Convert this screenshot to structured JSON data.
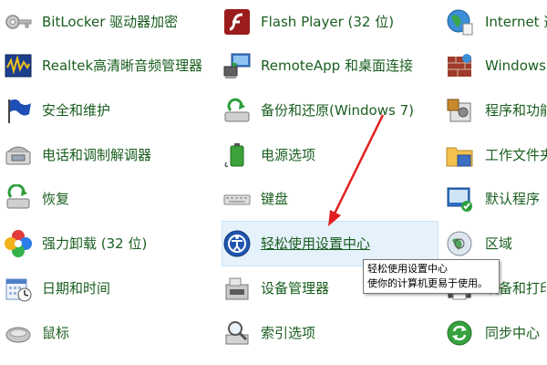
{
  "colors": {
    "link_text": "#1a5e1f",
    "hover_bg": "#e5f1fb",
    "arrow": "#e02020"
  },
  "columns": [
    {
      "items": [
        {
          "label": "BitLocker 驱动器加密",
          "icon": "bitlocker-key-icon"
        },
        {
          "label": "Realtek高清晰音频管理器",
          "icon": "realtek-audio-icon"
        },
        {
          "label": "安全和维护",
          "icon": "security-flag-icon"
        },
        {
          "label": "电话和调制解调器",
          "icon": "phone-modem-icon"
        },
        {
          "label": "恢复",
          "icon": "recovery-icon"
        },
        {
          "label": "强力卸载 (32 位)",
          "icon": "uninstall-flower-icon"
        },
        {
          "label": "日期和时间",
          "icon": "calendar-clock-icon"
        },
        {
          "label": "鼠标",
          "icon": "mouse-icon"
        }
      ]
    },
    {
      "items": [
        {
          "label": "Flash Player (32 位)",
          "icon": "flash-player-icon"
        },
        {
          "label": "RemoteApp 和桌面连接",
          "icon": "remoteapp-icon"
        },
        {
          "label": "备份和还原(Windows 7)",
          "icon": "backup-restore-icon"
        },
        {
          "label": "电源选项",
          "icon": "power-battery-icon"
        },
        {
          "label": "键盘",
          "icon": "keyboard-icon"
        },
        {
          "label": "轻松使用设置中心",
          "icon": "ease-of-access-icon"
        },
        {
          "label": "设备管理器",
          "icon": "device-manager-icon"
        },
        {
          "label": "索引选项",
          "icon": "indexing-icon"
        }
      ]
    },
    {
      "items": [
        {
          "label": "Internet 选",
          "icon": "internet-globe-icon"
        },
        {
          "label": "Windows 墙",
          "icon": "firewall-icon"
        },
        {
          "label": "程序和功能",
          "icon": "programs-features-icon"
        },
        {
          "label": "工作文件夹",
          "icon": "work-folders-icon"
        },
        {
          "label": "默认程序",
          "icon": "default-programs-icon"
        },
        {
          "label": "区域",
          "icon": "region-globe-icon"
        },
        {
          "label": "设备和打印",
          "icon": "devices-printers-icon"
        },
        {
          "label": "同步中心",
          "icon": "sync-center-icon"
        }
      ]
    }
  ],
  "tooltip": {
    "title": "轻松使用设置中心",
    "description": "使你的计算机更易于使用。"
  }
}
